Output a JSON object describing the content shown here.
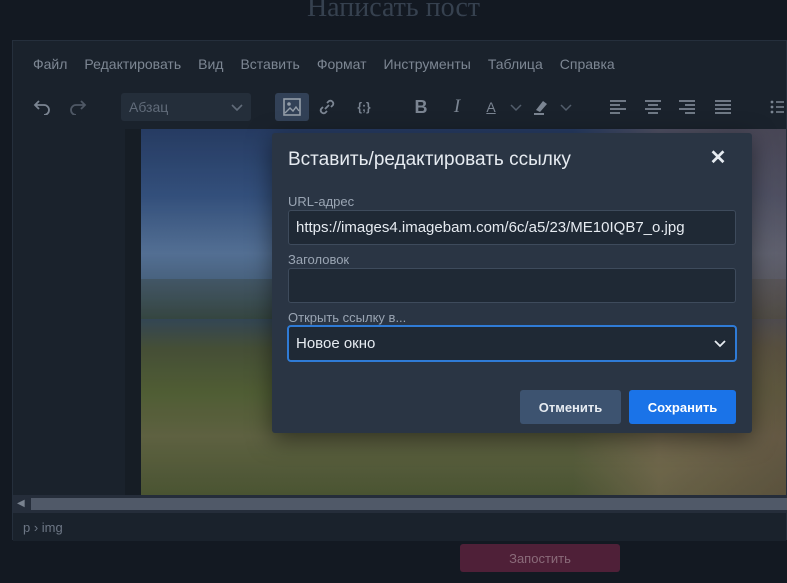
{
  "page": {
    "title": "Написать пост"
  },
  "menubar": {
    "items": [
      "Файл",
      "Редактировать",
      "Вид",
      "Вставить",
      "Формат",
      "Инструменты",
      "Таблица",
      "Справка"
    ]
  },
  "toolbar": {
    "block_format": "Абзац",
    "icons": [
      "undo-icon",
      "redo-icon",
      "image-icon",
      "link-icon",
      "code-sample-icon",
      "bold-icon",
      "italic-icon",
      "text-color-icon",
      "highlight-icon",
      "align-left-icon",
      "align-center-icon",
      "align-right-icon",
      "align-justify-icon",
      "bullet-list-icon"
    ],
    "bold_label": "B",
    "italic_label": "I",
    "text_color_label": "A",
    "code_label": "{;}"
  },
  "statusbar": {
    "path": "p › img"
  },
  "submit": {
    "label": "Запостить"
  },
  "dialog": {
    "title": "Вставить/редактировать ссылку",
    "close_label": "✕",
    "url_label": "URL-адрес",
    "url_value": "https://images4.imagebam.com/6c/a5/23/ME10IQB7_o.jpg",
    "title_label": "Заголовок",
    "title_value": "",
    "target_label": "Открыть ссылку в...",
    "target_value": "Новое окно",
    "cancel_label": "Отменить",
    "save_label": "Сохранить"
  },
  "colors": {
    "accent": "#1a73e8",
    "dialog_bg": "#2a3544",
    "submit_bg": "#5b2540"
  }
}
